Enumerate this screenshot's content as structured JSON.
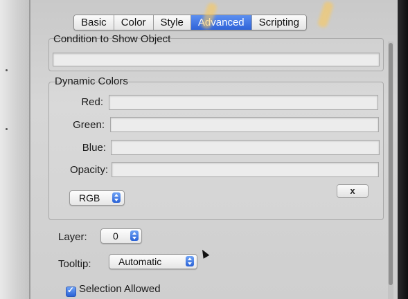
{
  "tabs": [
    {
      "label": "Basic",
      "active": false
    },
    {
      "label": "Color",
      "active": false
    },
    {
      "label": "Style",
      "active": false
    },
    {
      "label": "Advanced",
      "active": true
    },
    {
      "label": "Scripting",
      "active": false
    }
  ],
  "condition": {
    "legend": "Condition to Show Object",
    "value": ""
  },
  "dynamic_colors": {
    "legend": "Dynamic Colors",
    "rows": [
      {
        "label": "Red:",
        "value": ""
      },
      {
        "label": "Green:",
        "value": ""
      },
      {
        "label": "Blue:",
        "value": ""
      },
      {
        "label": "Opacity:",
        "value": ""
      }
    ],
    "color_mode": "RGB",
    "clear_button": "x"
  },
  "layer": {
    "label": "Layer:",
    "value": "0"
  },
  "tooltip": {
    "label": "Tooltip:",
    "value": "Automatic"
  },
  "selection": {
    "label": "Selection Allowed",
    "checked": true
  },
  "colors": {
    "accent": "#2f63d8",
    "panel": "#d0d0d0"
  }
}
